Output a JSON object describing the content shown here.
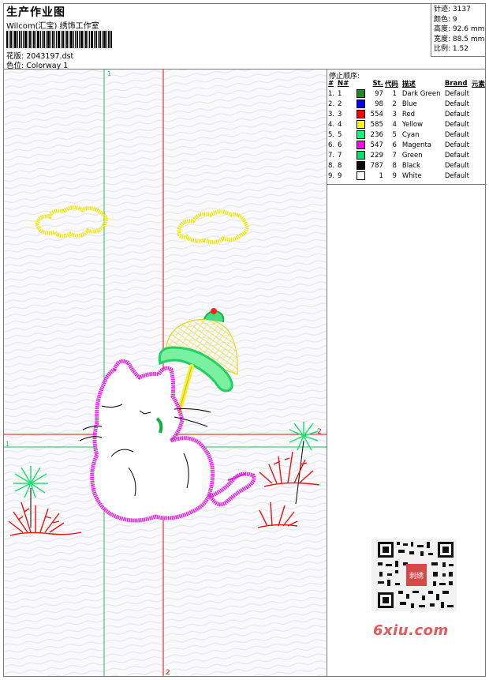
{
  "header": {
    "title": "生产作业图",
    "company": "Wilcom(汇宝) 绣饰工作室",
    "design_label": "花版:",
    "design_value": "2043197.dst",
    "colorway_label": "色位:",
    "colorway_value": "Colorway 1"
  },
  "stats": [
    {
      "label": "针迹:",
      "value": "3137"
    },
    {
      "label": "颜色:",
      "value": "9"
    },
    {
      "label": "高度:",
      "value": "92.6 mm"
    },
    {
      "label": "宽度:",
      "value": "88.5 mm"
    },
    {
      "label": "比例:",
      "value": "1.52"
    }
  ],
  "stop_sequence": {
    "title": "停止顺序:",
    "headers": [
      "#",
      "N#",
      "St.",
      "代码",
      "描述",
      "Brand",
      "元素"
    ],
    "rows": [
      {
        "idx": "1.",
        "n": "1",
        "color": "#1a8a2a",
        "st": "97",
        "code": "1",
        "desc": "Dark Green",
        "brand": "Default"
      },
      {
        "idx": "2.",
        "n": "2",
        "color": "#0000ff",
        "st": "98",
        "code": "2",
        "desc": "Blue",
        "brand": "Default"
      },
      {
        "idx": "3.",
        "n": "3",
        "color": "#ff0000",
        "st": "554",
        "code": "3",
        "desc": "Red",
        "brand": "Default"
      },
      {
        "idx": "4.",
        "n": "4",
        "color": "#ffff00",
        "st": "585",
        "code": "4",
        "desc": "Yellow",
        "brand": "Default"
      },
      {
        "idx": "5.",
        "n": "5",
        "color": "#00ff80",
        "st": "236",
        "code": "5",
        "desc": "Cyan",
        "brand": "Default"
      },
      {
        "idx": "6.",
        "n": "6",
        "color": "#ff00ff",
        "st": "547",
        "code": "6",
        "desc": "Magenta",
        "brand": "Default"
      },
      {
        "idx": "7.",
        "n": "7",
        "color": "#00e070",
        "st": "229",
        "code": "7",
        "desc": "Green",
        "brand": "Default"
      },
      {
        "idx": "8.",
        "n": "8",
        "color": "#000000",
        "st": "787",
        "code": "8",
        "desc": "Black",
        "brand": "Default"
      },
      {
        "idx": "9.",
        "n": "9",
        "color": "#ffffff",
        "st": "1",
        "code": "9",
        "desc": "White",
        "brand": "Default"
      }
    ]
  },
  "guides": {
    "vertical_1": "1",
    "vertical_2": "2",
    "horizontal_1": "1",
    "horizontal_2": "2",
    "green": "#20c060",
    "red": "#e01010"
  },
  "watermark": "6xiu.com",
  "stamp": "刺绣"
}
